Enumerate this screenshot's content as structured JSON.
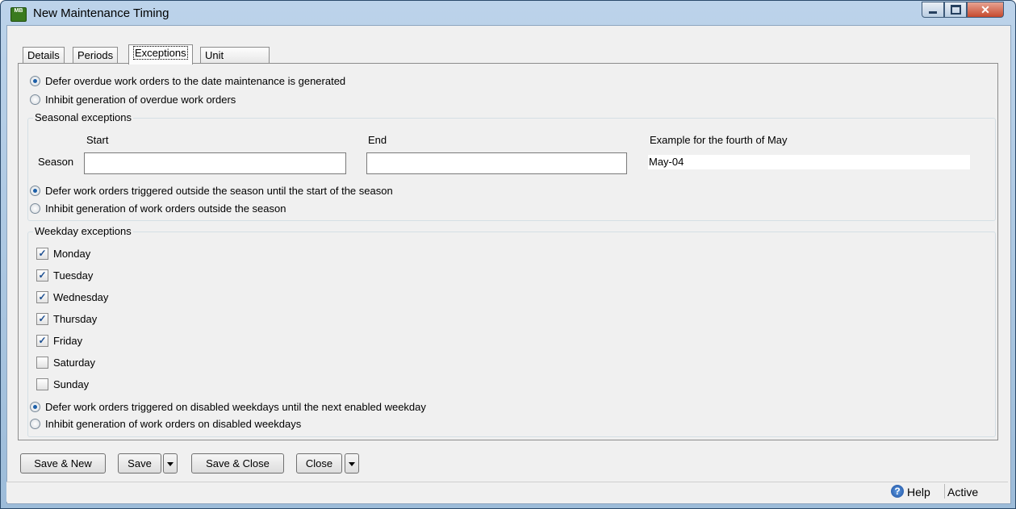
{
  "window": {
    "title": "New Maintenance Timing",
    "app_icon_text": "MB"
  },
  "tabs": [
    "Details",
    "Periods",
    "Exceptions",
    "Unit Maintenance Plans"
  ],
  "overdue": {
    "options": [
      "Defer overdue work orders to the date maintenance is generated",
      "Inhibit generation of overdue work orders"
    ],
    "selected": 0
  },
  "seasonal": {
    "legend": "Seasonal exceptions",
    "start_label": "Start",
    "end_label": "End",
    "example_label": "Example for the fourth of May",
    "season_label": "Season",
    "start_value": "",
    "end_value": "",
    "example_value": "May-04",
    "options": [
      "Defer work orders triggered outside the season until the start of the season",
      "Inhibit generation of work orders outside the season"
    ],
    "selected": 0
  },
  "weekday": {
    "legend": "Weekday exceptions",
    "days": [
      {
        "label": "Monday",
        "checked": true
      },
      {
        "label": "Tuesday",
        "checked": true
      },
      {
        "label": "Wednesday",
        "checked": true
      },
      {
        "label": "Thursday",
        "checked": true
      },
      {
        "label": "Friday",
        "checked": true
      },
      {
        "label": "Saturday",
        "checked": false
      },
      {
        "label": "Sunday",
        "checked": false
      }
    ],
    "options": [
      "Defer work orders triggered on disabled weekdays until the next enabled weekday",
      "Inhibit generation of work orders on disabled weekdays"
    ],
    "selected": 0
  },
  "buttons": {
    "save_new": "Save & New",
    "save": "Save",
    "save_close": "Save & Close",
    "close": "Close"
  },
  "status": {
    "help": "Help",
    "active": "Active"
  }
}
